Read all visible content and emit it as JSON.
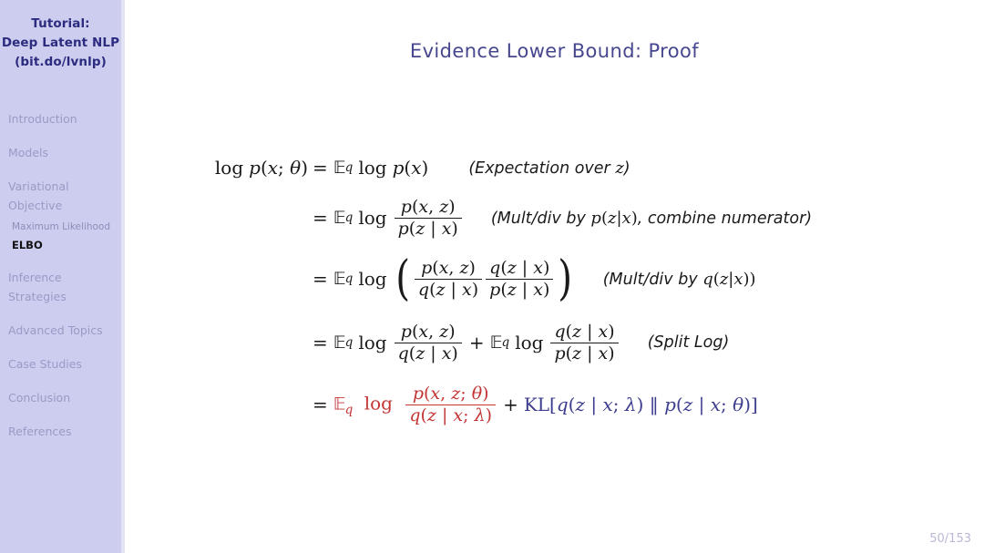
{
  "sidebar": {
    "title_lines": [
      "Tutorial:",
      "Deep Latent NLP",
      "(bit.do/lvnlp)"
    ],
    "sections": [
      {
        "name": "introduction",
        "lines": [
          "Introduction"
        ]
      },
      {
        "name": "models",
        "lines": [
          "Models"
        ]
      },
      {
        "name": "variational-objective",
        "lines": [
          "Variational",
          "Objective"
        ]
      },
      {
        "name": "inference-strategies",
        "lines": [
          "Inference",
          "Strategies"
        ]
      },
      {
        "name": "advanced-topics",
        "lines": [
          "Advanced Topics"
        ]
      },
      {
        "name": "case-studies",
        "lines": [
          "Case Studies"
        ]
      },
      {
        "name": "conclusion",
        "lines": [
          "Conclusion"
        ]
      },
      {
        "name": "references",
        "lines": [
          "References"
        ]
      }
    ],
    "subsections": [
      {
        "name": "maximum-likelihood",
        "label": "Maximum Likelihood",
        "active": false
      },
      {
        "name": "elbo",
        "label": "ELBO",
        "active": true
      }
    ],
    "colors": {
      "background": "#cdcdef",
      "title_text": "#2b2b7f",
      "item_text": "#9a9ac6",
      "active_item_text": "#111111"
    }
  },
  "slide": {
    "title": "Evidence Lower Bound: Proof",
    "title_color": "#474790",
    "background": "#ffffff",
    "page_number": "50/153",
    "page_number_color": "#b9b9d6"
  },
  "derivation": {
    "highlight_colors": {
      "red": "#c33434",
      "blue": "#3d3d8f"
    },
    "lines": [
      {
        "id": "line-1",
        "lhs": "log p(x; θ)",
        "relation": "=",
        "rhs": "E_q log p(x)",
        "annotation": "(Expectation over z)"
      },
      {
        "id": "line-2",
        "lhs": "",
        "relation": "=",
        "rhs": "E_q log p(x, z) / p(z | x)",
        "annotation": "(Mult/div by p(z|x), combine numerator)"
      },
      {
        "id": "line-3",
        "lhs": "",
        "relation": "=",
        "rhs": "E_q log ( p(x, z)/q(z | x) · q(z | x)/p(z | x) )",
        "annotation": "(Mult/div by q(z|x))"
      },
      {
        "id": "line-4",
        "lhs": "",
        "relation": "=",
        "rhs": "E_q log p(x, z)/q(z | x) + E_q log q(z | x)/p(z | x)",
        "annotation": "(Split Log)"
      },
      {
        "id": "line-5",
        "lhs": "",
        "relation": "=",
        "rhs": "E_q log p(x, z; θ)/q(z | x; λ) + KL[q(z | x; λ) || p(z | x; θ)]",
        "annotation": ""
      }
    ]
  }
}
